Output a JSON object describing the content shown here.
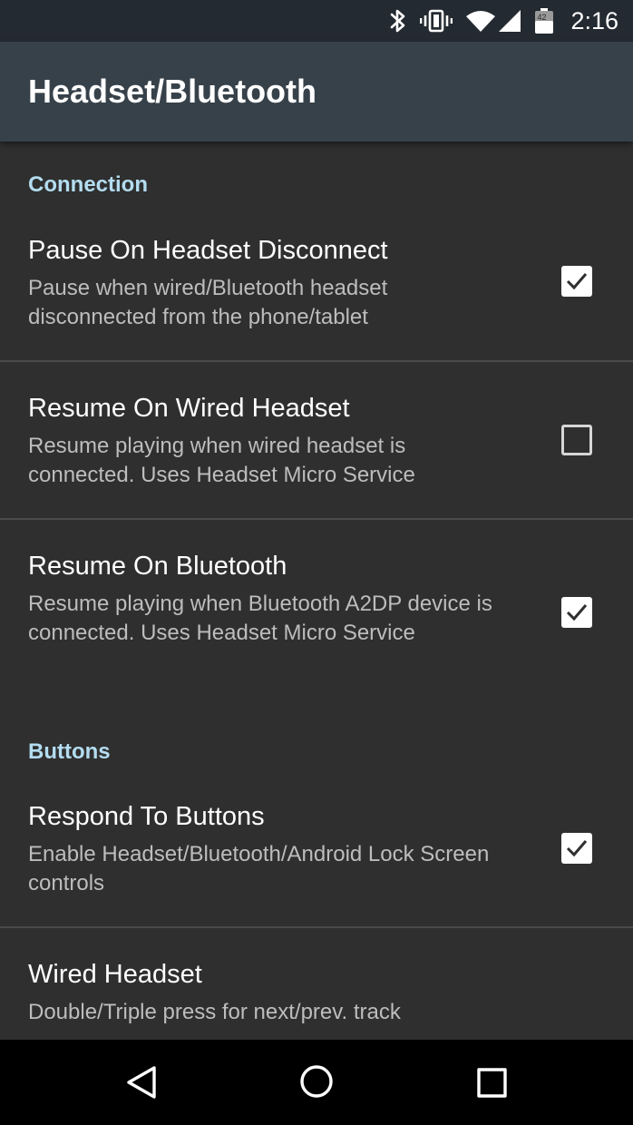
{
  "status_bar": {
    "time": "2:16",
    "battery_level": "42",
    "icons": [
      "bluetooth-icon",
      "vibrate-icon",
      "wifi-icon",
      "cell-signal-icon",
      "battery-icon"
    ]
  },
  "app_bar": {
    "title": "Headset/Bluetooth"
  },
  "sections": {
    "connection": {
      "header": "Connection",
      "items": [
        {
          "title": "Pause On Headset Disconnect",
          "summary": "Pause when wired/Bluetooth headset disconnected from the phone/tablet",
          "checked": true
        },
        {
          "title": "Resume On Wired Headset",
          "summary": "Resume playing when wired headset is connected. Uses Headset Micro Service",
          "checked": false
        },
        {
          "title": "Resume On Bluetooth",
          "summary": "Resume playing when Bluetooth A2DP device is connected. Uses Headset Micro Service",
          "checked": true
        }
      ]
    },
    "buttons": {
      "header": "Buttons",
      "items": [
        {
          "title": "Respond To Buttons",
          "summary": "Enable Headset/Bluetooth/Android Lock Screen controls",
          "checked": true
        },
        {
          "title": "Wired Headset",
          "summary": "Double/Triple press for next/prev. track"
        }
      ]
    }
  },
  "nav_bar": {
    "icons": [
      "back-icon",
      "home-icon",
      "recents-icon"
    ]
  },
  "colors": {
    "status_bar_bg": "#242a31",
    "app_bar_bg": "#37414a",
    "content_bg": "#2f2f2f",
    "category_text": "#b3dcf0",
    "summary_text": "#bdbdbd"
  }
}
